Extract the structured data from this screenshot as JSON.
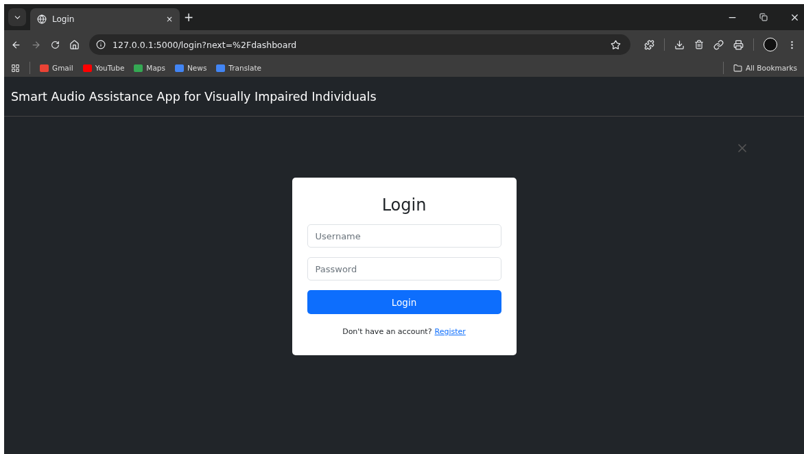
{
  "tab": {
    "title": "Login",
    "close": "×",
    "new_tab": "+"
  },
  "address": {
    "url": "127.0.0.1:5000/login?next=%2Fdashboard"
  },
  "bookmarks": [
    {
      "label": "Gmail",
      "color": "#ea4335"
    },
    {
      "label": "YouTube",
      "color": "#ff0000"
    },
    {
      "label": "Maps",
      "color": "#34a853"
    },
    {
      "label": "News",
      "color": "#4285f4"
    },
    {
      "label": "Translate",
      "color": "#4285f4"
    }
  ],
  "all_bookmarks": "All Bookmarks",
  "navbar": {
    "brand": "Smart Audio Assistance App for Visually Impaired Individuals"
  },
  "modal": {
    "title": "Login",
    "fields": [
      {
        "placeholder": "Username"
      },
      {
        "placeholder": "Password"
      }
    ],
    "submit": "Login",
    "footer_text": "Don't have an account?",
    "footer_link": "Register"
  }
}
